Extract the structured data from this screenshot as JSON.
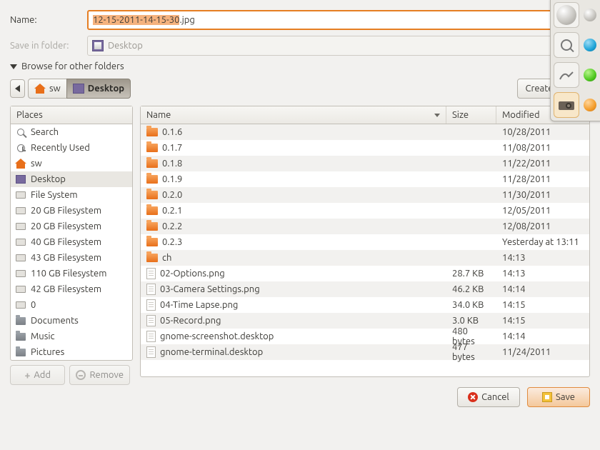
{
  "labels": {
    "name": "Name:",
    "save_in": "Save in folder:",
    "browse": "Browse for other folders",
    "places_header": "Places",
    "create_folder": "Create Folder",
    "add": "Add",
    "remove": "Remove",
    "cancel": "Cancel",
    "save": "Save"
  },
  "filename": {
    "selected": "12-15-2011-14-15-30",
    "suffix": ".jpg"
  },
  "save_folder_display": "Desktop",
  "path_segments": [
    {
      "label": "sw",
      "icon": "home",
      "active": false
    },
    {
      "label": "Desktop",
      "icon": "desktop",
      "active": true
    }
  ],
  "columns": {
    "name": "Name",
    "size": "Size",
    "modified": "Modified"
  },
  "places": [
    {
      "label": "Search",
      "icon": "search"
    },
    {
      "label": "Recently Used",
      "icon": "clock"
    },
    {
      "label": "sw",
      "icon": "home"
    },
    {
      "label": "Desktop",
      "icon": "desktop",
      "selected": true
    },
    {
      "label": "File System",
      "icon": "drive"
    },
    {
      "label": "20 GB Filesystem",
      "icon": "drive"
    },
    {
      "label": "20 GB Filesystem",
      "icon": "drive"
    },
    {
      "label": "40 GB Filesystem",
      "icon": "drive"
    },
    {
      "label": "43 GB Filesystem",
      "icon": "drive"
    },
    {
      "label": "110 GB Filesystem",
      "icon": "drive"
    },
    {
      "label": "42 GB Filesystem",
      "icon": "drive"
    },
    {
      "label": "0",
      "icon": "drive"
    },
    {
      "label": "Documents",
      "icon": "folder-grey"
    },
    {
      "label": "Music",
      "icon": "folder-grey"
    },
    {
      "label": "Pictures",
      "icon": "folder-grey"
    }
  ],
  "files": [
    {
      "name": "0.1.6",
      "type": "folder",
      "size": "",
      "modified": "10/28/2011"
    },
    {
      "name": "0.1.7",
      "type": "folder",
      "size": "",
      "modified": "11/08/2011"
    },
    {
      "name": "0.1.8",
      "type": "folder",
      "size": "",
      "modified": "11/22/2011"
    },
    {
      "name": "0.1.9",
      "type": "folder",
      "size": "",
      "modified": "11/28/2011"
    },
    {
      "name": "0.2.0",
      "type": "folder",
      "size": "",
      "modified": "11/30/2011"
    },
    {
      "name": "0.2.1",
      "type": "folder",
      "size": "",
      "modified": "12/05/2011"
    },
    {
      "name": "0.2.2",
      "type": "folder",
      "size": "",
      "modified": "12/08/2011"
    },
    {
      "name": "0.2.3",
      "type": "folder",
      "size": "",
      "modified": "Yesterday at 13:11"
    },
    {
      "name": "ch",
      "type": "folder",
      "size": "",
      "modified": "14:13"
    },
    {
      "name": "02-Options.png",
      "type": "file",
      "size": "28.7 KB",
      "modified": "14:13"
    },
    {
      "name": "03-Camera Settings.png",
      "type": "file",
      "size": "46.2 KB",
      "modified": "14:14"
    },
    {
      "name": "04-Time Lapse.png",
      "type": "file",
      "size": "34.0 KB",
      "modified": "14:15"
    },
    {
      "name": "05-Record.png",
      "type": "file",
      "size": "3.0 KB",
      "modified": "14:15"
    },
    {
      "name": "gnome-screenshot.desktop",
      "type": "file",
      "size": "480 bytes",
      "modified": "14:14"
    },
    {
      "name": "gnome-terminal.desktop",
      "type": "file",
      "size": "477 bytes",
      "modified": "11/24/2011"
    }
  ],
  "dock": [
    {
      "name": "zoom",
      "side": "blue"
    },
    {
      "name": "draw",
      "side": "green"
    },
    {
      "name": "camera",
      "side": "orange"
    }
  ]
}
